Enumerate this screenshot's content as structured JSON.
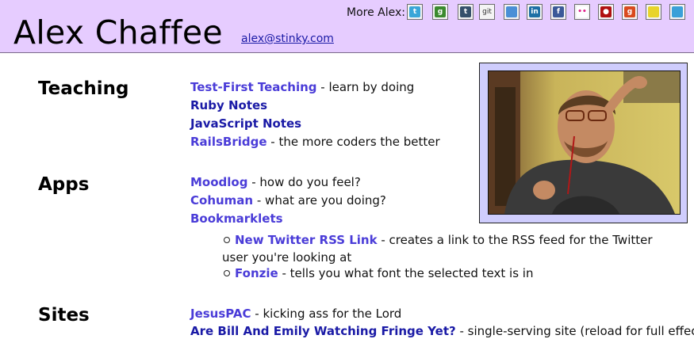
{
  "header": {
    "title": "Alex Chaffee",
    "email": "alex@stinky.com",
    "more_label": "More Alex:",
    "icons": [
      {
        "name": "twitter-icon",
        "glyph": "t",
        "color": "#3aa6d8"
      },
      {
        "name": "google-profile-icon",
        "glyph": "g",
        "color": "#3b8a2e"
      },
      {
        "name": "tumblr-icon",
        "glyph": "t",
        "color": "#35506b"
      },
      {
        "name": "github-icon",
        "glyph": "git",
        "color": "#777777"
      },
      {
        "name": "delicious-icon",
        "glyph": "",
        "color": "#4a8fd6"
      },
      {
        "name": "linkedin-icon",
        "glyph": "in",
        "color": "#1d6fa5"
      },
      {
        "name": "facebook-icon",
        "glyph": "f",
        "color": "#3b5998"
      },
      {
        "name": "flickr-icon",
        "glyph": "••",
        "color": "#ffffff"
      },
      {
        "name": "lastfm-icon",
        "glyph": "●",
        "color": "#b01010"
      },
      {
        "name": "google-reader-icon",
        "glyph": "g",
        "color": "#d94a1e"
      },
      {
        "name": "slideshare-icon",
        "glyph": "",
        "color": "#e8d42a"
      },
      {
        "name": "feed-icon",
        "glyph": "",
        "color": "#3aa0d8"
      }
    ]
  },
  "sections": {
    "teaching": {
      "label": "Teaching",
      "items": [
        {
          "link": "Test-First Teaching",
          "text": " - learn by doing"
        },
        {
          "link": "Ruby Notes",
          "text": ""
        },
        {
          "link": "JavaScript Notes",
          "text": ""
        },
        {
          "link": "RailsBridge",
          "text": " - the more coders the better"
        }
      ]
    },
    "apps": {
      "label": "Apps",
      "items": [
        {
          "link": "Moodlog",
          "text": " - how do you feel?"
        },
        {
          "link": "Cohuman",
          "text": " - what are you doing?"
        },
        {
          "link": "Bookmarklets",
          "text": ""
        }
      ],
      "subitems": [
        {
          "link": "New Twitter RSS Link",
          "text": " - creates a link to the RSS feed for the Twitter user you're looking at"
        },
        {
          "link": "Fonzie",
          "text": " - tells you what font the selected text is in"
        }
      ]
    },
    "sites": {
      "label": "Sites",
      "items": [
        {
          "link": "JesusPAC",
          "text": " - kicking ass for the Lord"
        },
        {
          "link": "Are Bill And Emily Watching Fringe Yet?",
          "text": " - single-serving site (reload for full effect)"
        }
      ]
    }
  },
  "colors": {
    "header_bg": "#e6ccff",
    "link": "#4a3cd8",
    "link_visited": "#1a1aa6",
    "photo_frame": "#cfcdfd"
  }
}
